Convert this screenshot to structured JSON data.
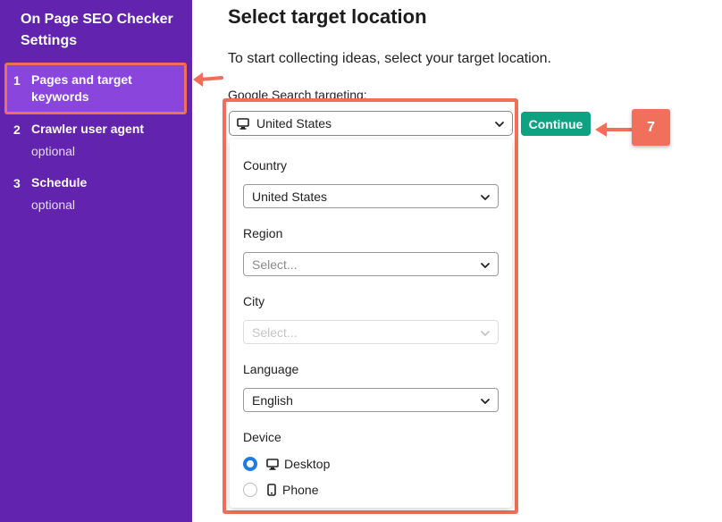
{
  "sidebar": {
    "title": "On Page SEO Checker Settings",
    "items": [
      {
        "num": "1",
        "label": "Pages and target keywords",
        "sub": ""
      },
      {
        "num": "2",
        "label": "Crawler user agent",
        "sub": "optional"
      },
      {
        "num": "3",
        "label": "Schedule",
        "sub": "optional"
      }
    ]
  },
  "main": {
    "title": "Select target location",
    "intro": "To start collecting ideas, select your target location.",
    "targeting_label": "Google Search targeting:",
    "targeting_value": "United States",
    "continue_label": "Continue"
  },
  "annotation": {
    "step_badge": "7"
  },
  "dropdown": {
    "country_label": "Country",
    "country_value": "United States",
    "region_label": "Region",
    "region_placeholder": "Select...",
    "city_label": "City",
    "city_placeholder": "Select...",
    "language_label": "Language",
    "language_value": "English",
    "device_label": "Device",
    "devices": [
      {
        "label": "Desktop",
        "selected": true,
        "icon": "monitor-icon"
      },
      {
        "label": "Phone",
        "selected": false,
        "icon": "phone-icon"
      }
    ]
  },
  "colors": {
    "sidebar_bg": "#6223ae",
    "sidebar_active_bg": "#8a45dd",
    "annotation": "#f06e5a",
    "continue_bg": "#0ea182",
    "radio_selected": "#1e7de0"
  }
}
